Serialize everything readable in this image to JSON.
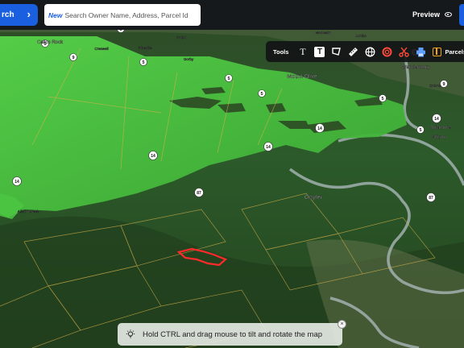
{
  "header": {
    "search_button_label": "rch",
    "search_new_tag": "New",
    "search_placeholder": "Search Owner Name, Address, Parcel Id",
    "preview_label": "Preview"
  },
  "toolbar": {
    "tools_label": "Tools",
    "text_label": "T",
    "text_box_label": "T",
    "parcels_label": "Parcels"
  },
  "map": {
    "place_labels": [
      "Calico Rock",
      "Mount Olive",
      "Sylamore",
      "Allison",
      "Brandenburg",
      "Gayler",
      "Creswell",
      "Dolph",
      "Gorby",
      "Jumbo",
      "Moccasin",
      "Pineville",
      "Allison Creek",
      "Onions"
    ],
    "route_shields": [
      "5",
      "5",
      "9",
      "5",
      "9",
      "5",
      "5",
      "5",
      "14",
      "14",
      "14",
      "14",
      "14",
      "87",
      "87",
      "5",
      "9"
    ],
    "colors": {
      "forest_overlay": "#44c53a",
      "selected_parcel": "#ff2a2a",
      "parcel_lines": "#d7b24c",
      "river": "#a9b7b6"
    }
  },
  "hint": {
    "text": "Hold CTRL and drag mouse to tilt and rotate the map",
    "close_symbol": "×"
  }
}
